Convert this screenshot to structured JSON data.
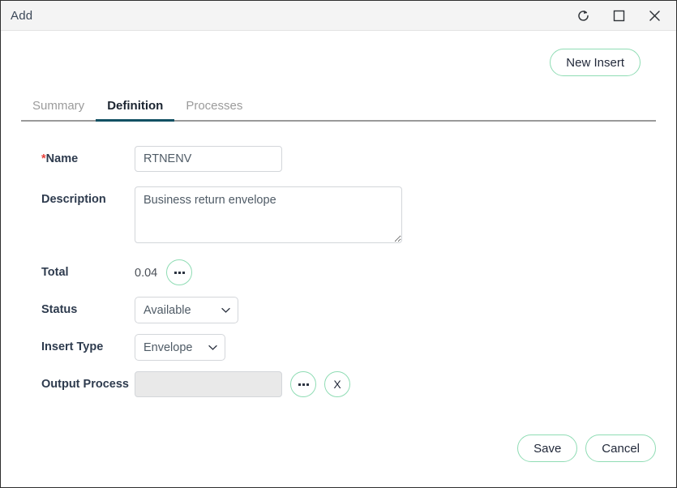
{
  "window": {
    "title": "Add",
    "controls": [
      {
        "name": "refresh-icon",
        "label": "Refresh"
      },
      {
        "name": "maximize-icon",
        "label": "Maximize"
      },
      {
        "name": "close-icon",
        "label": "Close"
      }
    ]
  },
  "toolbar": {
    "new_insert_label": "New Insert"
  },
  "tabs": [
    {
      "label": "Summary",
      "active": false
    },
    {
      "label": "Definition",
      "active": true
    },
    {
      "label": "Processes",
      "active": false
    }
  ],
  "form": {
    "name": {
      "label": "Name",
      "required_marker": "*",
      "value": "RTNENV",
      "placeholder": ""
    },
    "description": {
      "label": "Description",
      "value": "Business return envelope",
      "placeholder": ""
    },
    "total": {
      "label": "Total",
      "value": "0.04",
      "ellipsis_button_label": "..."
    },
    "status": {
      "label": "Status",
      "value": "Available",
      "options": [
        "Available"
      ]
    },
    "insert_type": {
      "label": "Insert Type",
      "value": "Envelope",
      "options": [
        "Envelope"
      ]
    },
    "output_process": {
      "label": "Output Process",
      "value": "",
      "placeholder": "",
      "ellipsis_button_label": "...",
      "clear_button_label": "X"
    }
  },
  "footer": {
    "save_label": "Save",
    "cancel_label": "Cancel"
  },
  "colors": {
    "accent_green": "#8fdcb4",
    "active_tab_underline": "#125063",
    "required_red": "#e8413a",
    "titlebar_bg": "#f4f4f4"
  }
}
